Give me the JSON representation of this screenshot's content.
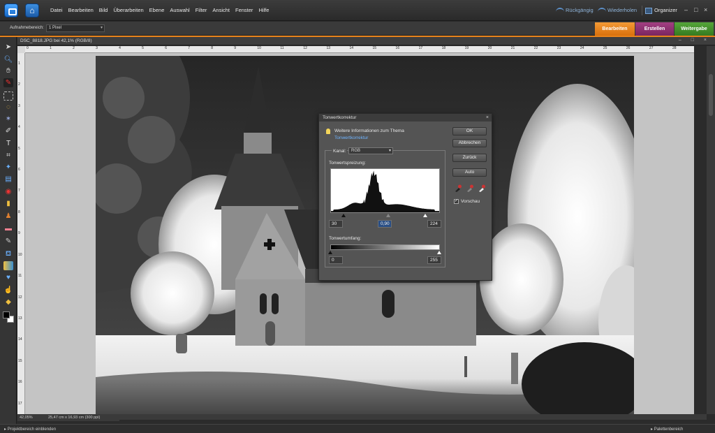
{
  "menubar": {
    "items": [
      "Datei",
      "Bearbeiten",
      "Bild",
      "Überarbeiten",
      "Ebene",
      "Auswahl",
      "Filter",
      "Ansicht",
      "Fenster",
      "Hilfe"
    ],
    "undo_label": "Rückgängig",
    "redo_label": "Wiederholen",
    "organizer_label": "Organizer",
    "window_controls": [
      "–",
      "□",
      "×"
    ]
  },
  "options": {
    "sample_label": "Aufnahmebereich:",
    "sample_value": "1 Pixel"
  },
  "mode_tabs": [
    {
      "label": "Bearbeiten",
      "color": "#e8831b"
    },
    {
      "label": "Erstellen",
      "color": "#8e2f6f"
    },
    {
      "label": "Weitergabe",
      "color": "#3f8f2a"
    }
  ],
  "document": {
    "title": "DSC_8818.JPG bei 42,1% (RGB/8)",
    "tab_controls": "– □ ×",
    "ruler_h": [
      "0",
      "1",
      "2",
      "3",
      "4",
      "5",
      "6",
      "7",
      "8",
      "9",
      "10",
      "11",
      "12",
      "13",
      "14",
      "15",
      "16",
      "17",
      "18",
      "19",
      "20",
      "21",
      "22",
      "23",
      "24",
      "25",
      "26",
      "27",
      "28"
    ],
    "ruler_v": [
      "1",
      "2",
      "3",
      "4",
      "5",
      "6",
      "7",
      "8",
      "9",
      "10",
      "11",
      "12",
      "13",
      "14",
      "15",
      "16",
      "17"
    ]
  },
  "status": {
    "zoom": "42,05%",
    "dims": "25,47 cm x 16,93 cm (300 ppi)"
  },
  "bottom": {
    "project_bin": "Projektbereich einblenden",
    "palette_bin": "Palettenbereich"
  },
  "dialog": {
    "title": "Tonwertkorrektur",
    "close": "×",
    "info_text": "Weitere Informationen zum Thema",
    "info_link": "Tonwertkorrektur",
    "channel_label": "Kanal:",
    "channel_value": "RGB",
    "input_label": "Tonwertspreizung:",
    "input_black": "30",
    "input_gamma": "0,90",
    "input_white": "224",
    "output_label": "Tonwertumfang:",
    "output_black": "0",
    "output_white": "255",
    "buttons": {
      "ok": "OK",
      "cancel": "Abbrechen",
      "reset": "Zurück",
      "auto": "Auto"
    },
    "preview_label": "Vorschau",
    "preview_checked": true
  },
  "colors": {
    "accent_orange": "#e8831b",
    "link_blue": "#6fb4ff"
  }
}
